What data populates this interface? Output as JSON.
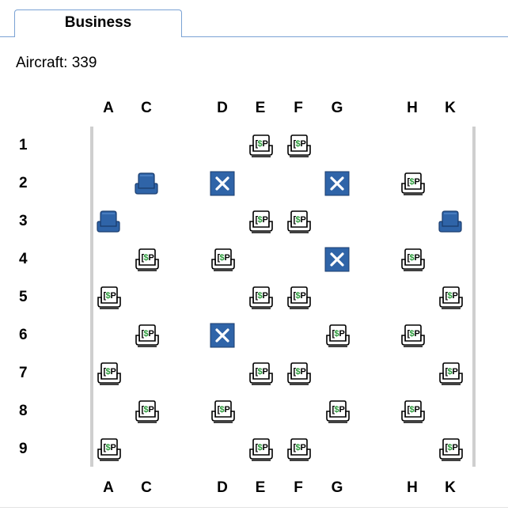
{
  "tab": {
    "label": "Business"
  },
  "aircraft_label": "Aircraft: 339",
  "columns": [
    "A",
    "C",
    "D",
    "E",
    "F",
    "G",
    "H",
    "K"
  ],
  "rows": [
    "1",
    "2",
    "3",
    "4",
    "5",
    "6",
    "7",
    "8",
    "9"
  ],
  "colors": {
    "occupied_seat": "#2f64a8",
    "blocked_seat": "#2f64a8",
    "paid_seat_icon": "#2a9a3a",
    "tab_border": "#7aa2d4"
  },
  "legend": {
    "P": "paid-seat-icon",
    "O": "occupied-seat-icon",
    "X": "blocked-seat-icon",
    "-": "empty"
  },
  "seat_map": [
    [
      "-",
      "-",
      "-",
      "P",
      "P",
      "-",
      "-",
      "-"
    ],
    [
      "-",
      "O",
      "X",
      "-",
      "-",
      "X",
      "P",
      "-"
    ],
    [
      "O",
      "-",
      "-",
      "P",
      "P",
      "-",
      "-",
      "O"
    ],
    [
      "-",
      "P",
      "P",
      "-",
      "-",
      "X",
      "P",
      "-"
    ],
    [
      "P",
      "-",
      "-",
      "P",
      "P",
      "-",
      "-",
      "P"
    ],
    [
      "-",
      "P",
      "X",
      "-",
      "-",
      "P",
      "P",
      "-"
    ],
    [
      "P",
      "-",
      "-",
      "P",
      "P",
      "-",
      "-",
      "P"
    ],
    [
      "-",
      "P",
      "P",
      "-",
      "-",
      "P",
      "P",
      "-"
    ],
    [
      "P",
      "-",
      "-",
      "P",
      "P",
      "-",
      "-",
      "P"
    ]
  ]
}
